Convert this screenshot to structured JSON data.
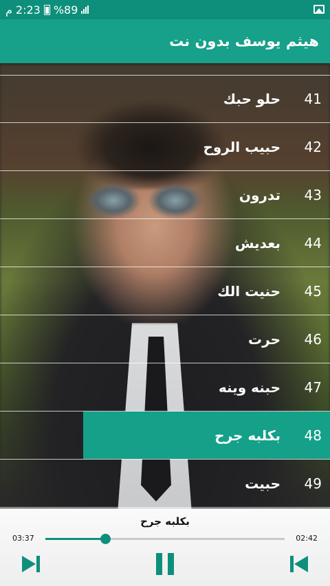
{
  "status_bar": {
    "time": "2:23",
    "carrier_glyph": "م",
    "battery": "%89"
  },
  "app_bar": {
    "title": "هيثم يوسف بدون نت"
  },
  "songs": [
    {
      "number": "41",
      "title": "حلو حبك"
    },
    {
      "number": "42",
      "title": "حبيب الروح"
    },
    {
      "number": "43",
      "title": "تدرون"
    },
    {
      "number": "44",
      "title": "بعديش"
    },
    {
      "number": "45",
      "title": "حنيت الك"
    },
    {
      "number": "46",
      "title": "حرت"
    },
    {
      "number": "47",
      "title": "حبنه وينه"
    },
    {
      "number": "48",
      "title": "بكلبه جرح"
    },
    {
      "number": "49",
      "title": "حبيت"
    }
  ],
  "player": {
    "now_playing": "بكلبه جرح",
    "elapsed": "03:37",
    "remaining": "02:42",
    "progress": 0.25,
    "accent_color": "#0e8f7c",
    "icons": [
      "skip-next-icon",
      "pause-icon",
      "skip-previous-icon"
    ]
  },
  "colors": {
    "app_bar": "#17a08a",
    "status_bar": "#0e8f7c",
    "highlight": "#15a089"
  }
}
